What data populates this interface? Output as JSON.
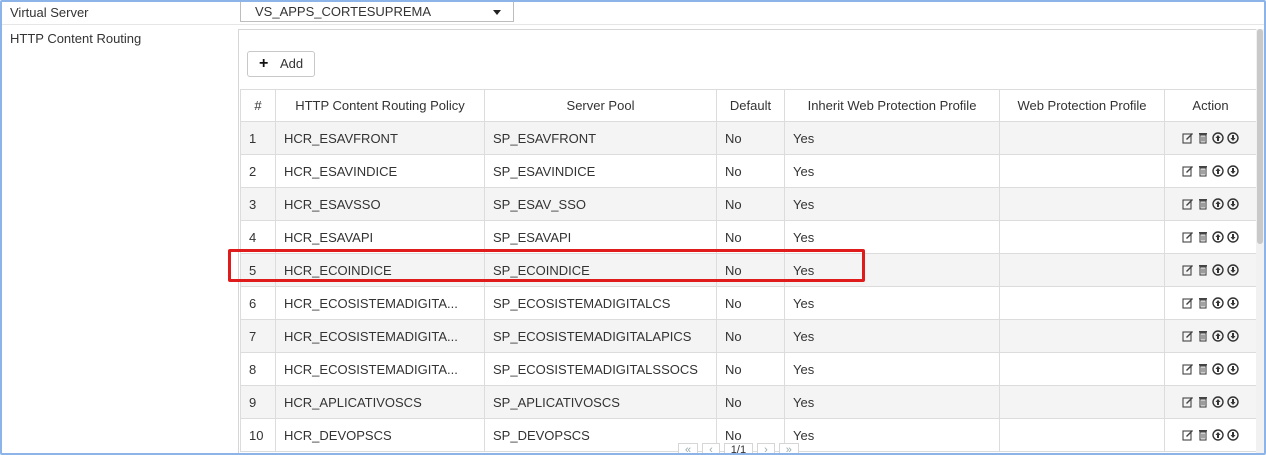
{
  "form": {
    "virtual_server_label": "Virtual Server",
    "virtual_server_value": "VS_APPS_CORTESUPREMA",
    "hcr_label": "HTTP Content Routing",
    "add_label": "Add"
  },
  "table": {
    "headers": [
      "#",
      "HTTP Content Routing Policy",
      "Server Pool",
      "Default",
      "Inherit Web Protection Profile",
      "Web Protection Profile",
      "Action"
    ],
    "rows": [
      {
        "num": "1",
        "policy": "HCR_ESAVFRONT",
        "pool": "SP_ESAVFRONT",
        "default": "No",
        "inherit": "Yes",
        "profile": ""
      },
      {
        "num": "2",
        "policy": "HCR_ESAVINDICE",
        "pool": "SP_ESAVINDICE",
        "default": "No",
        "inherit": "Yes",
        "profile": ""
      },
      {
        "num": "3",
        "policy": "HCR_ESAVSSO",
        "pool": "SP_ESAV_SSO",
        "default": "No",
        "inherit": "Yes",
        "profile": ""
      },
      {
        "num": "4",
        "policy": "HCR_ESAVAPI",
        "pool": "SP_ESAVAPI",
        "default": "No",
        "inherit": "Yes",
        "profile": ""
      },
      {
        "num": "5",
        "policy": "HCR_ECOINDICE",
        "pool": "SP_ECOINDICE",
        "default": "No",
        "inherit": "Yes",
        "profile": ""
      },
      {
        "num": "6",
        "policy": "HCR_ECOSISTEMADIGITA...",
        "pool": "SP_ECOSISTEMADIGITALCS",
        "default": "No",
        "inherit": "Yes",
        "profile": ""
      },
      {
        "num": "7",
        "policy": "HCR_ECOSISTEMADIGITA...",
        "pool": "SP_ECOSISTEMADIGITALAPICS",
        "default": "No",
        "inherit": "Yes",
        "profile": ""
      },
      {
        "num": "8",
        "policy": "HCR_ECOSISTEMADIGITA...",
        "pool": "SP_ECOSISTEMADIGITALSSOCS",
        "default": "No",
        "inherit": "Yes",
        "profile": ""
      },
      {
        "num": "9",
        "policy": "HCR_APLICATIVOSCS",
        "pool": "SP_APLICATIVOSCS",
        "default": "No",
        "inherit": "Yes",
        "profile": ""
      },
      {
        "num": "10",
        "policy": "HCR_DEVOPSCS",
        "pool": "SP_DEVOPSCS",
        "default": "No",
        "inherit": "Yes",
        "profile": ""
      }
    ],
    "action_icons": [
      "edit-icon",
      "trash-icon",
      "move-up-icon",
      "move-down-icon"
    ]
  },
  "pager": {
    "first": "«",
    "prev": "‹",
    "page": "1/1",
    "next": "›",
    "last": "»"
  },
  "colors": {
    "frame_border": "#8cb4e8",
    "highlight": "#e01b1b"
  }
}
